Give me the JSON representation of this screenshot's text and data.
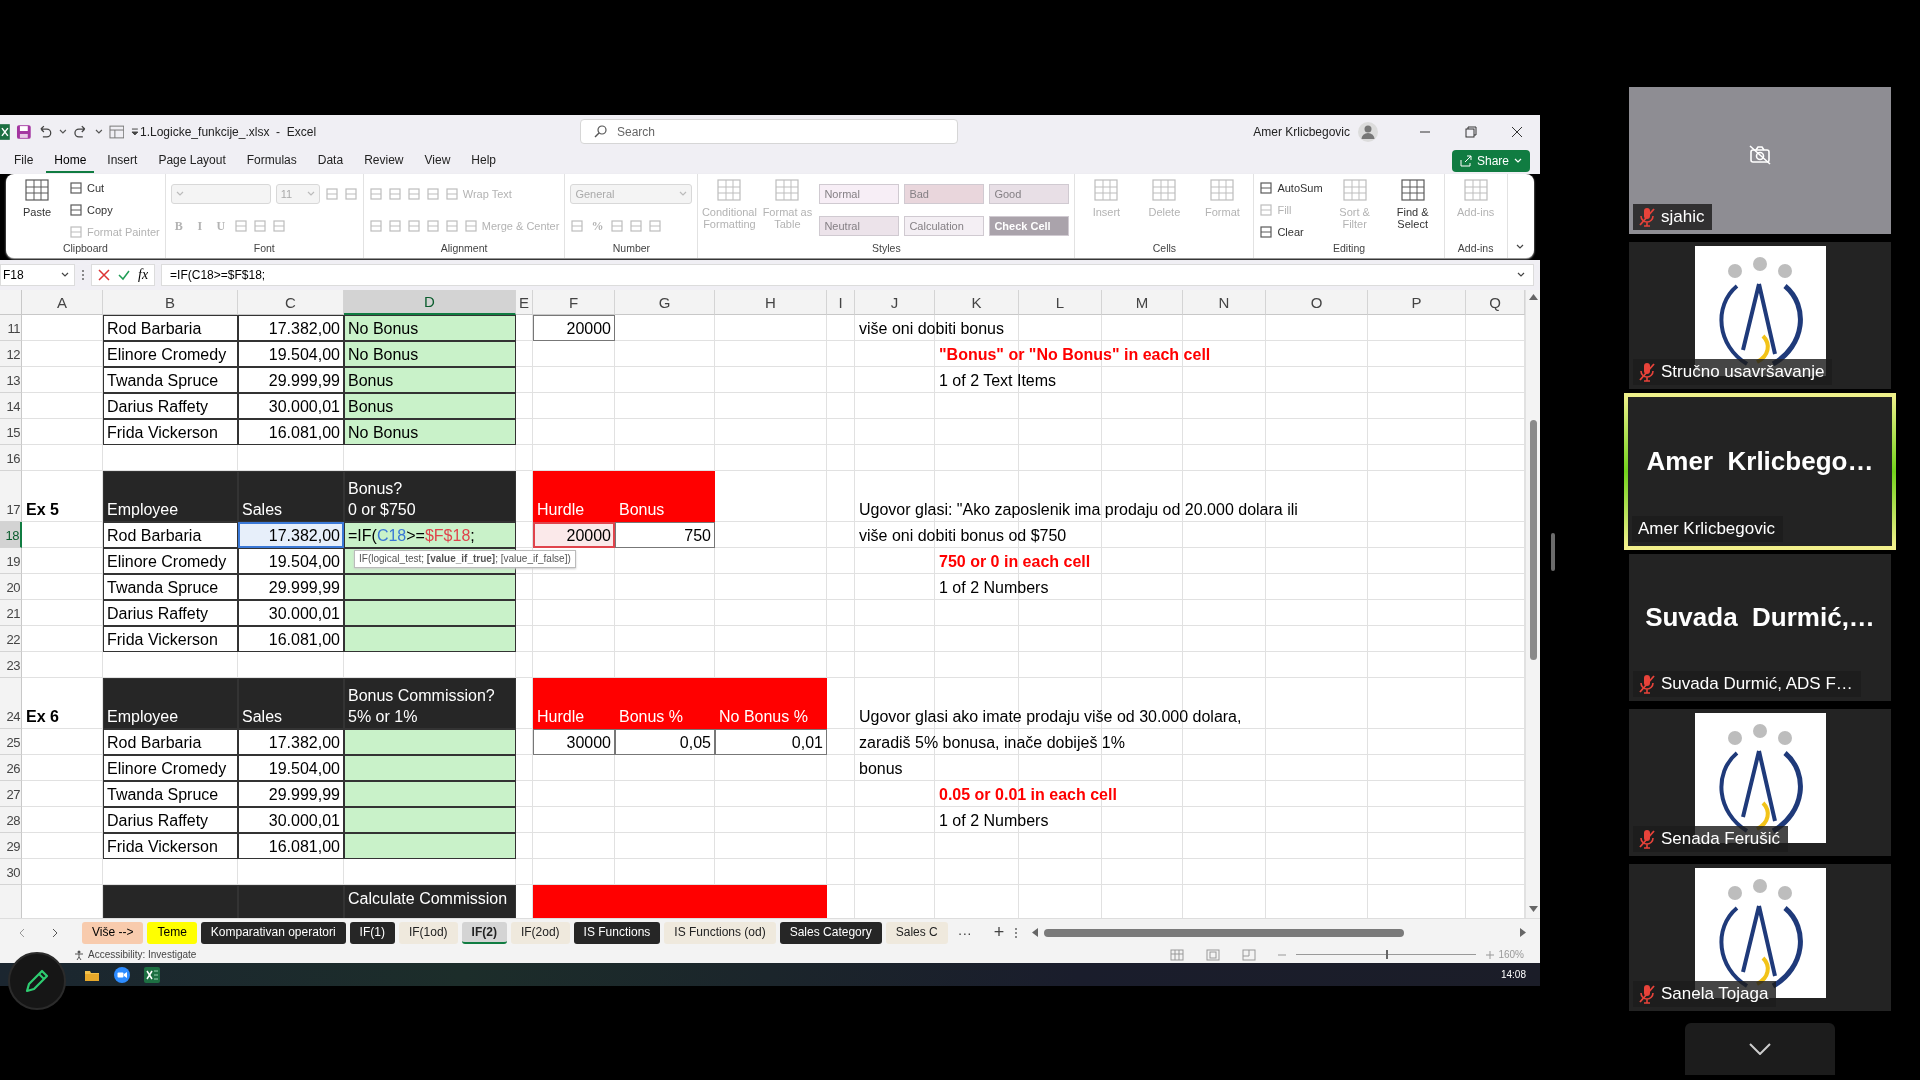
{
  "title_bar": {
    "title": "1.Logicke_funkcije_.xlsx  -  Excel",
    "search_placeholder": "Search",
    "user": "Amer Krlicbegovic"
  },
  "menu": [
    {
      "label": "File",
      "selected": false
    },
    {
      "label": "Home",
      "selected": true
    },
    {
      "label": "Insert",
      "selected": false
    },
    {
      "label": "Page Layout",
      "selected": false
    },
    {
      "label": "Formulas",
      "selected": false
    },
    {
      "label": "Data",
      "selected": false
    },
    {
      "label": "Review",
      "selected": false
    },
    {
      "label": "View",
      "selected": false
    },
    {
      "label": "Help",
      "selected": false
    }
  ],
  "share_button": "Share",
  "ribbon": {
    "groups": [
      {
        "name": "Clipboard",
        "columns": [
          {
            "kind": "large",
            "label": "Paste",
            "disabled": false
          },
          {
            "kind": "stack",
            "rows": [
              [
                {
                  "kind": "small",
                  "label": "Cut",
                  "disabled": false
                }
              ],
              [
                {
                  "kind": "small",
                  "label": "Copy",
                  "disabled": false
                }
              ],
              [
                {
                  "kind": "small",
                  "label": "Format Painter",
                  "disabled": true
                }
              ]
            ]
          }
        ]
      },
      {
        "name": "Font",
        "columns": [
          {
            "kind": "stack",
            "rows": [
              [
                {
                  "kind": "select",
                  "disabled": true
                },
                {
                  "kind": "select",
                  "label": "11",
                  "disabled": true
                },
                {
                  "kind": "icon",
                  "disabled": true
                },
                {
                  "kind": "icon",
                  "disabled": true
                }
              ],
              [
                {
                  "kind": "glyph",
                  "label": "B",
                  "disabled": true
                },
                {
                  "kind": "glyph",
                  "label": "I",
                  "disabled": true
                },
                {
                  "kind": "glyph",
                  "label": "U",
                  "disabled": true
                },
                {
                  "kind": "icon",
                  "disabled": true
                },
                {
                  "kind": "icon",
                  "disabled": true
                },
                {
                  "kind": "icon",
                  "disabled": true
                }
              ]
            ]
          }
        ]
      },
      {
        "name": "Alignment",
        "columns": [
          {
            "kind": "stack",
            "rows": [
              [
                {
                  "kind": "icon",
                  "disabled": true
                },
                {
                  "kind": "icon",
                  "disabled": true
                },
                {
                  "kind": "icon",
                  "disabled": true
                },
                {
                  "kind": "icon",
                  "disabled": true
                },
                {
                  "kind": "small",
                  "label": "Wrap Text",
                  "disabled": true
                }
              ],
              [
                {
                  "kind": "icon",
                  "disabled": true
                },
                {
                  "kind": "icon",
                  "disabled": true
                },
                {
                  "kind": "icon",
                  "disabled": true
                },
                {
                  "kind": "icon",
                  "disabled": true
                },
                {
                  "kind": "icon",
                  "disabled": true
                },
                {
                  "kind": "small",
                  "label": "Merge & Center",
                  "disabled": true
                }
              ]
            ]
          }
        ]
      },
      {
        "name": "Number",
        "columns": [
          {
            "kind": "stack",
            "rows": [
              [
                {
                  "kind": "select",
                  "label": "General",
                  "disabled": true
                }
              ],
              [
                {
                  "kind": "icon",
                  "disabled": true
                },
                {
                  "kind": "glyph",
                  "label": "%",
                  "disabled": true
                },
                {
                  "kind": "icon",
                  "disabled": true
                },
                {
                  "kind": "icon",
                  "disabled": true
                },
                {
                  "kind": "icon",
                  "disabled": true
                }
              ]
            ]
          }
        ]
      },
      {
        "name": "Styles",
        "columns": [
          {
            "kind": "large",
            "label": "Conditional Formatting",
            "disabled": true
          },
          {
            "kind": "large",
            "label": "Format as Table",
            "disabled": true
          },
          {
            "kind": "stack",
            "rows": [
              [
                {
                  "kind": "style",
                  "label": "Normal",
                  "color": "#f7eef6",
                  "disabled": true
                },
                {
                  "kind": "style",
                  "label": "Bad",
                  "color": "#e9d6dc",
                  "disabled": true
                },
                {
                  "kind": "style",
                  "label": "Good",
                  "color": "#e8dfe6",
                  "disabled": true
                }
              ],
              [
                {
                  "kind": "style",
                  "label": "Neutral",
                  "color": "#ece3ea",
                  "disabled": true
                },
                {
                  "kind": "style",
                  "label": "Calculation",
                  "color": "#f4eff4",
                  "disabled": true
                },
                {
                  "kind": "style",
                  "label": "Check Cell",
                  "color": "#aaa3ab",
                  "disabled": true
                }
              ]
            ]
          }
        ]
      },
      {
        "name": "Cells",
        "columns": [
          {
            "kind": "large",
            "label": "Insert",
            "disabled": true
          },
          {
            "kind": "large",
            "label": "Delete",
            "disabled": true
          },
          {
            "kind": "large",
            "label": "Format",
            "disabled": true
          }
        ]
      },
      {
        "name": "Editing",
        "columns": [
          {
            "kind": "stack",
            "rows": [
              [
                {
                  "kind": "small",
                  "label": "AutoSum",
                  "disabled": false
                }
              ],
              [
                {
                  "kind": "small",
                  "label": "Fill",
                  "disabled": true
                }
              ],
              [
                {
                  "kind": "small",
                  "label": "Clear",
                  "disabled": false
                }
              ]
            ]
          },
          {
            "kind": "large",
            "label": "Sort & Filter",
            "disabled": true
          },
          {
            "kind": "large",
            "label": "Find & Select",
            "disabled": false
          }
        ]
      },
      {
        "name": "Add-ins",
        "columns": [
          {
            "kind": "large",
            "label": "Add-ins",
            "disabled": true
          }
        ]
      }
    ]
  },
  "formula_bar": {
    "name_box": "F18",
    "fx": "fx",
    "formula": "=IF(C18>=$F$18;"
  },
  "sheet": {
    "columns": [
      {
        "label": "A",
        "selected": false
      },
      {
        "label": "B",
        "selected": false
      },
      {
        "label": "C",
        "selected": false
      },
      {
        "label": "D",
        "selected": true
      },
      {
        "label": "E",
        "selected": false
      },
      {
        "label": "F",
        "selected": false
      },
      {
        "label": "G",
        "selected": false
      },
      {
        "label": "H",
        "selected": false
      },
      {
        "label": "I",
        "selected": false
      },
      {
        "label": "J",
        "selected": false
      },
      {
        "label": "K",
        "selected": false
      },
      {
        "label": "L",
        "selected": false
      },
      {
        "label": "M",
        "selected": false
      },
      {
        "label": "N",
        "selected": false
      },
      {
        "label": "O",
        "selected": false
      },
      {
        "label": "P",
        "selected": false
      },
      {
        "label": "Q",
        "selected": false
      }
    ],
    "rows": [
      {
        "label": "11",
        "selected": false,
        "tall": false,
        "cells": {
          "B": {
            "kind": "text",
            "text": "Rod Barbaria"
          },
          "C": {
            "kind": "number",
            "text": "17.382,00"
          },
          "D": {
            "kind": "result",
            "text": "No Bonus"
          },
          "F": {
            "kind": "param",
            "text": "20000"
          },
          "J": {
            "kind": "note",
            "text": "više oni dobiti bonus"
          }
        }
      },
      {
        "label": "12",
        "selected": false,
        "tall": false,
        "cells": {
          "B": {
            "kind": "text",
            "text": "Elinore Cromedy"
          },
          "C": {
            "kind": "number",
            "text": "19.504,00"
          },
          "D": {
            "kind": "result",
            "text": "No Bonus"
          },
          "K": {
            "kind": "alert",
            "text": "\"Bonus\" or \"No Bonus\" in each cell"
          }
        }
      },
      {
        "label": "13",
        "selected": false,
        "tall": false,
        "cells": {
          "B": {
            "kind": "text",
            "text": "Twanda Spruce"
          },
          "C": {
            "kind": "number",
            "text": "29.999,99"
          },
          "D": {
            "kind": "result",
            "text": "Bonus"
          },
          "K": {
            "kind": "note",
            "text": "1 of 2 Text Items"
          }
        }
      },
      {
        "label": "14",
        "selected": false,
        "tall": false,
        "cells": {
          "B": {
            "kind": "text",
            "text": "Darius Raffety"
          },
          "C": {
            "kind": "number",
            "text": "30.000,01"
          },
          "D": {
            "kind": "result",
            "text": "Bonus"
          }
        }
      },
      {
        "label": "15",
        "selected": false,
        "tall": false,
        "cells": {
          "B": {
            "kind": "text",
            "text": "Frida Vickerson"
          },
          "C": {
            "kind": "number",
            "text": "16.081,00"
          },
          "D": {
            "kind": "result",
            "text": "No Bonus"
          }
        }
      },
      {
        "label": "16",
        "selected": false,
        "tall": false
      },
      {
        "label": "17",
        "selected": false,
        "tall": true,
        "cells": {
          "A": {
            "kind": "label",
            "text": "Ex 5"
          },
          "B": {
            "kind": "head",
            "text": "Employee"
          },
          "C": {
            "kind": "head",
            "text": "Sales"
          },
          "D": {
            "kind": "head",
            "text": "Bonus?\n0 or $750"
          },
          "F": {
            "kind": "red",
            "text": "Hurdle"
          },
          "G": {
            "kind": "red",
            "text": "Bonus"
          },
          "J": {
            "kind": "note",
            "text": "Ugovor glasi: \"Ako zaposlenik ima prodaju od 20.000 dolara ili"
          }
        }
      },
      {
        "label": "18",
        "selected": true,
        "tall": false,
        "cells": {
          "B": {
            "kind": "text",
            "text": "Rod Barbaria"
          },
          "C": {
            "kind": "number",
            "text": "17.382,00",
            "color": "#3a78d6"
          },
          "D": {
            "kind": "formula",
            "parts": [
              {
                "text": "=IF("
              },
              {
                "text": "C18",
                "color": "#3a78d6"
              },
              {
                "text": ">="
              },
              {
                "text": "$F$18",
                "color": "#e0444c"
              },
              {
                "text": ";"
              }
            ],
            "tooltip": "IF(logical_test; **[value_if_true]**; [value_if_false])"
          },
          "F": {
            "kind": "param",
            "text": "20000",
            "color": "#e0444c"
          },
          "G": {
            "kind": "param",
            "text": "750"
          },
          "J": {
            "kind": "note",
            "text": "više oni dobiti bonus od $750"
          }
        }
      },
      {
        "label": "19",
        "selected": false,
        "tall": false,
        "cells": {
          "B": {
            "kind": "text",
            "text": "Elinore Cromedy"
          },
          "C": {
            "kind": "number",
            "text": "19.504,00"
          },
          "D": {
            "kind": "result"
          },
          "K": {
            "kind": "alert",
            "text": "750 or 0 in each cell"
          }
        }
      },
      {
        "label": "20",
        "selected": false,
        "tall": false,
        "cells": {
          "B": {
            "kind": "text",
            "text": "Twanda Spruce"
          },
          "C": {
            "kind": "number",
            "text": "29.999,99"
          },
          "D": {
            "kind": "result"
          },
          "K": {
            "kind": "note",
            "text": "1 of 2 Numbers"
          }
        }
      },
      {
        "label": "21",
        "selected": false,
        "tall": false,
        "cells": {
          "B": {
            "kind": "text",
            "text": "Darius Raffety"
          },
          "C": {
            "kind": "number",
            "text": "30.000,01"
          },
          "D": {
            "kind": "result"
          }
        }
      },
      {
        "label": "22",
        "selected": false,
        "tall": false,
        "cells": {
          "B": {
            "kind": "text",
            "text": "Frida Vickerson"
          },
          "C": {
            "kind": "number",
            "text": "16.081,00"
          },
          "D": {
            "kind": "result"
          }
        }
      },
      {
        "label": "23",
        "selected": false,
        "tall": false
      },
      {
        "label": "24",
        "selected": false,
        "tall": true,
        "cells": {
          "A": {
            "kind": "label",
            "text": "Ex 6"
          },
          "B": {
            "kind": "head",
            "text": "Employee"
          },
          "C": {
            "kind": "head",
            "text": "Sales"
          },
          "D": {
            "kind": "head",
            "text": "Bonus Commission?\n5% or 1%"
          },
          "F": {
            "kind": "red",
            "text": "Hurdle"
          },
          "G": {
            "kind": "red",
            "text": "Bonus %"
          },
          "H": {
            "kind": "red",
            "text": "No Bonus %"
          },
          "J": {
            "kind": "note",
            "text": "Ugovor glasi ako imate prodaju više od 30.000 dolara,"
          }
        }
      },
      {
        "label": "25",
        "selected": false,
        "tall": false,
        "cells": {
          "B": {
            "kind": "text",
            "text": "Rod Barbaria"
          },
          "C": {
            "kind": "number",
            "text": "17.382,00"
          },
          "D": {
            "kind": "result"
          },
          "F": {
            "kind": "param",
            "text": "30000"
          },
          "G": {
            "kind": "param",
            "text": "0,05"
          },
          "H": {
            "kind": "param",
            "text": "0,01"
          },
          "J": {
            "kind": "note",
            "text": "zaradiš 5% bonusa, inače dobiješ 1%"
          }
        }
      },
      {
        "label": "26",
        "selected": false,
        "tall": false,
        "cells": {
          "B": {
            "kind": "text",
            "text": "Elinore Cromedy"
          },
          "C": {
            "kind": "number",
            "text": "19.504,00"
          },
          "D": {
            "kind": "result"
          },
          "J": {
            "kind": "note",
            "text": "bonus"
          }
        }
      },
      {
        "label": "27",
        "selected": false,
        "tall": false,
        "cells": {
          "B": {
            "kind": "text",
            "text": "Twanda Spruce"
          },
          "C": {
            "kind": "number",
            "text": "29.999,99"
          },
          "D": {
            "kind": "result"
          },
          "K": {
            "kind": "alert",
            "text": "0.05 or 0.01 in each cell"
          }
        }
      },
      {
        "label": "28",
        "selected": false,
        "tall": false,
        "cells": {
          "B": {
            "kind": "text",
            "text": "Darius Raffety"
          },
          "C": {
            "kind": "number",
            "text": "30.000,01"
          },
          "D": {
            "kind": "result"
          },
          "K": {
            "kind": "note",
            "text": "1 of 2 Numbers"
          }
        }
      },
      {
        "label": "29",
        "selected": false,
        "tall": false,
        "cells": {
          "B": {
            "kind": "text",
            "text": "Frida Vickerson"
          },
          "C": {
            "kind": "number",
            "text": "16.081,00"
          },
          "D": {
            "kind": "result"
          }
        }
      },
      {
        "label": "30",
        "selected": false,
        "tall": false
      },
      {
        "selected": false,
        "tall": true,
        "cells": {
          "B": {
            "kind": "head"
          },
          "C": {
            "kind": "head"
          },
          "D": {
            "kind": "head_top",
            "text": "Calculate Commission"
          },
          "F": {
            "kind": "red"
          },
          "G": {
            "kind": "red"
          },
          "H": {
            "kind": "red"
          }
        }
      }
    ]
  },
  "sheet_tabs": [
    {
      "label": "Više -->",
      "selected": false,
      "color": "#f8cbad"
    },
    {
      "label": "Teme",
      "selected": false,
      "color": "#ffff00"
    },
    {
      "label": "Komparativan operatori",
      "selected": false,
      "color": "#262626"
    },
    {
      "label": "IF(1)",
      "selected": false,
      "color": "#262626"
    },
    {
      "label": "IF(1od)",
      "selected": false
    },
    {
      "label": "IF(2)",
      "selected": true
    },
    {
      "label": "IF(2od)",
      "selected": false
    },
    {
      "label": "IS Functions",
      "selected": false,
      "color": "#262626"
    },
    {
      "label": "IS Functions (od)",
      "selected": false
    },
    {
      "label": "Sales Category",
      "selected": false,
      "color": "#262626"
    },
    {
      "label": "Sales C",
      "selected": false
    }
  ],
  "tab_more": "···",
  "tab_add": "+",
  "status_bar": {
    "accessibility": "Accessibility: Investigate",
    "zoom_slider": {
      "level": 0.5
    },
    "zoom": "160%"
  },
  "taskbar": {
    "time": "14:08"
  },
  "participants": [
    {
      "name": "sjahic",
      "kind": "camera_off",
      "muted": true,
      "speaking": false
    },
    {
      "name": "Stručno usavršavanje",
      "kind": "picture",
      "muted": true,
      "speaking": false
    },
    {
      "name": "Amer Krlicbegovic",
      "display": "Amer  Krlicbego…",
      "kind": "name",
      "muted": false,
      "speaking": true
    },
    {
      "name": "Suvada Durmić, ADS F…",
      "display": "Suvada  Durmić,…",
      "kind": "name",
      "muted": true,
      "speaking": false
    },
    {
      "name": "Senada Ferušić",
      "kind": "picture",
      "muted": true,
      "speaking": false
    },
    {
      "name": "Sanela Tojaga",
      "kind": "picture",
      "muted": true,
      "speaking": false
    }
  ]
}
